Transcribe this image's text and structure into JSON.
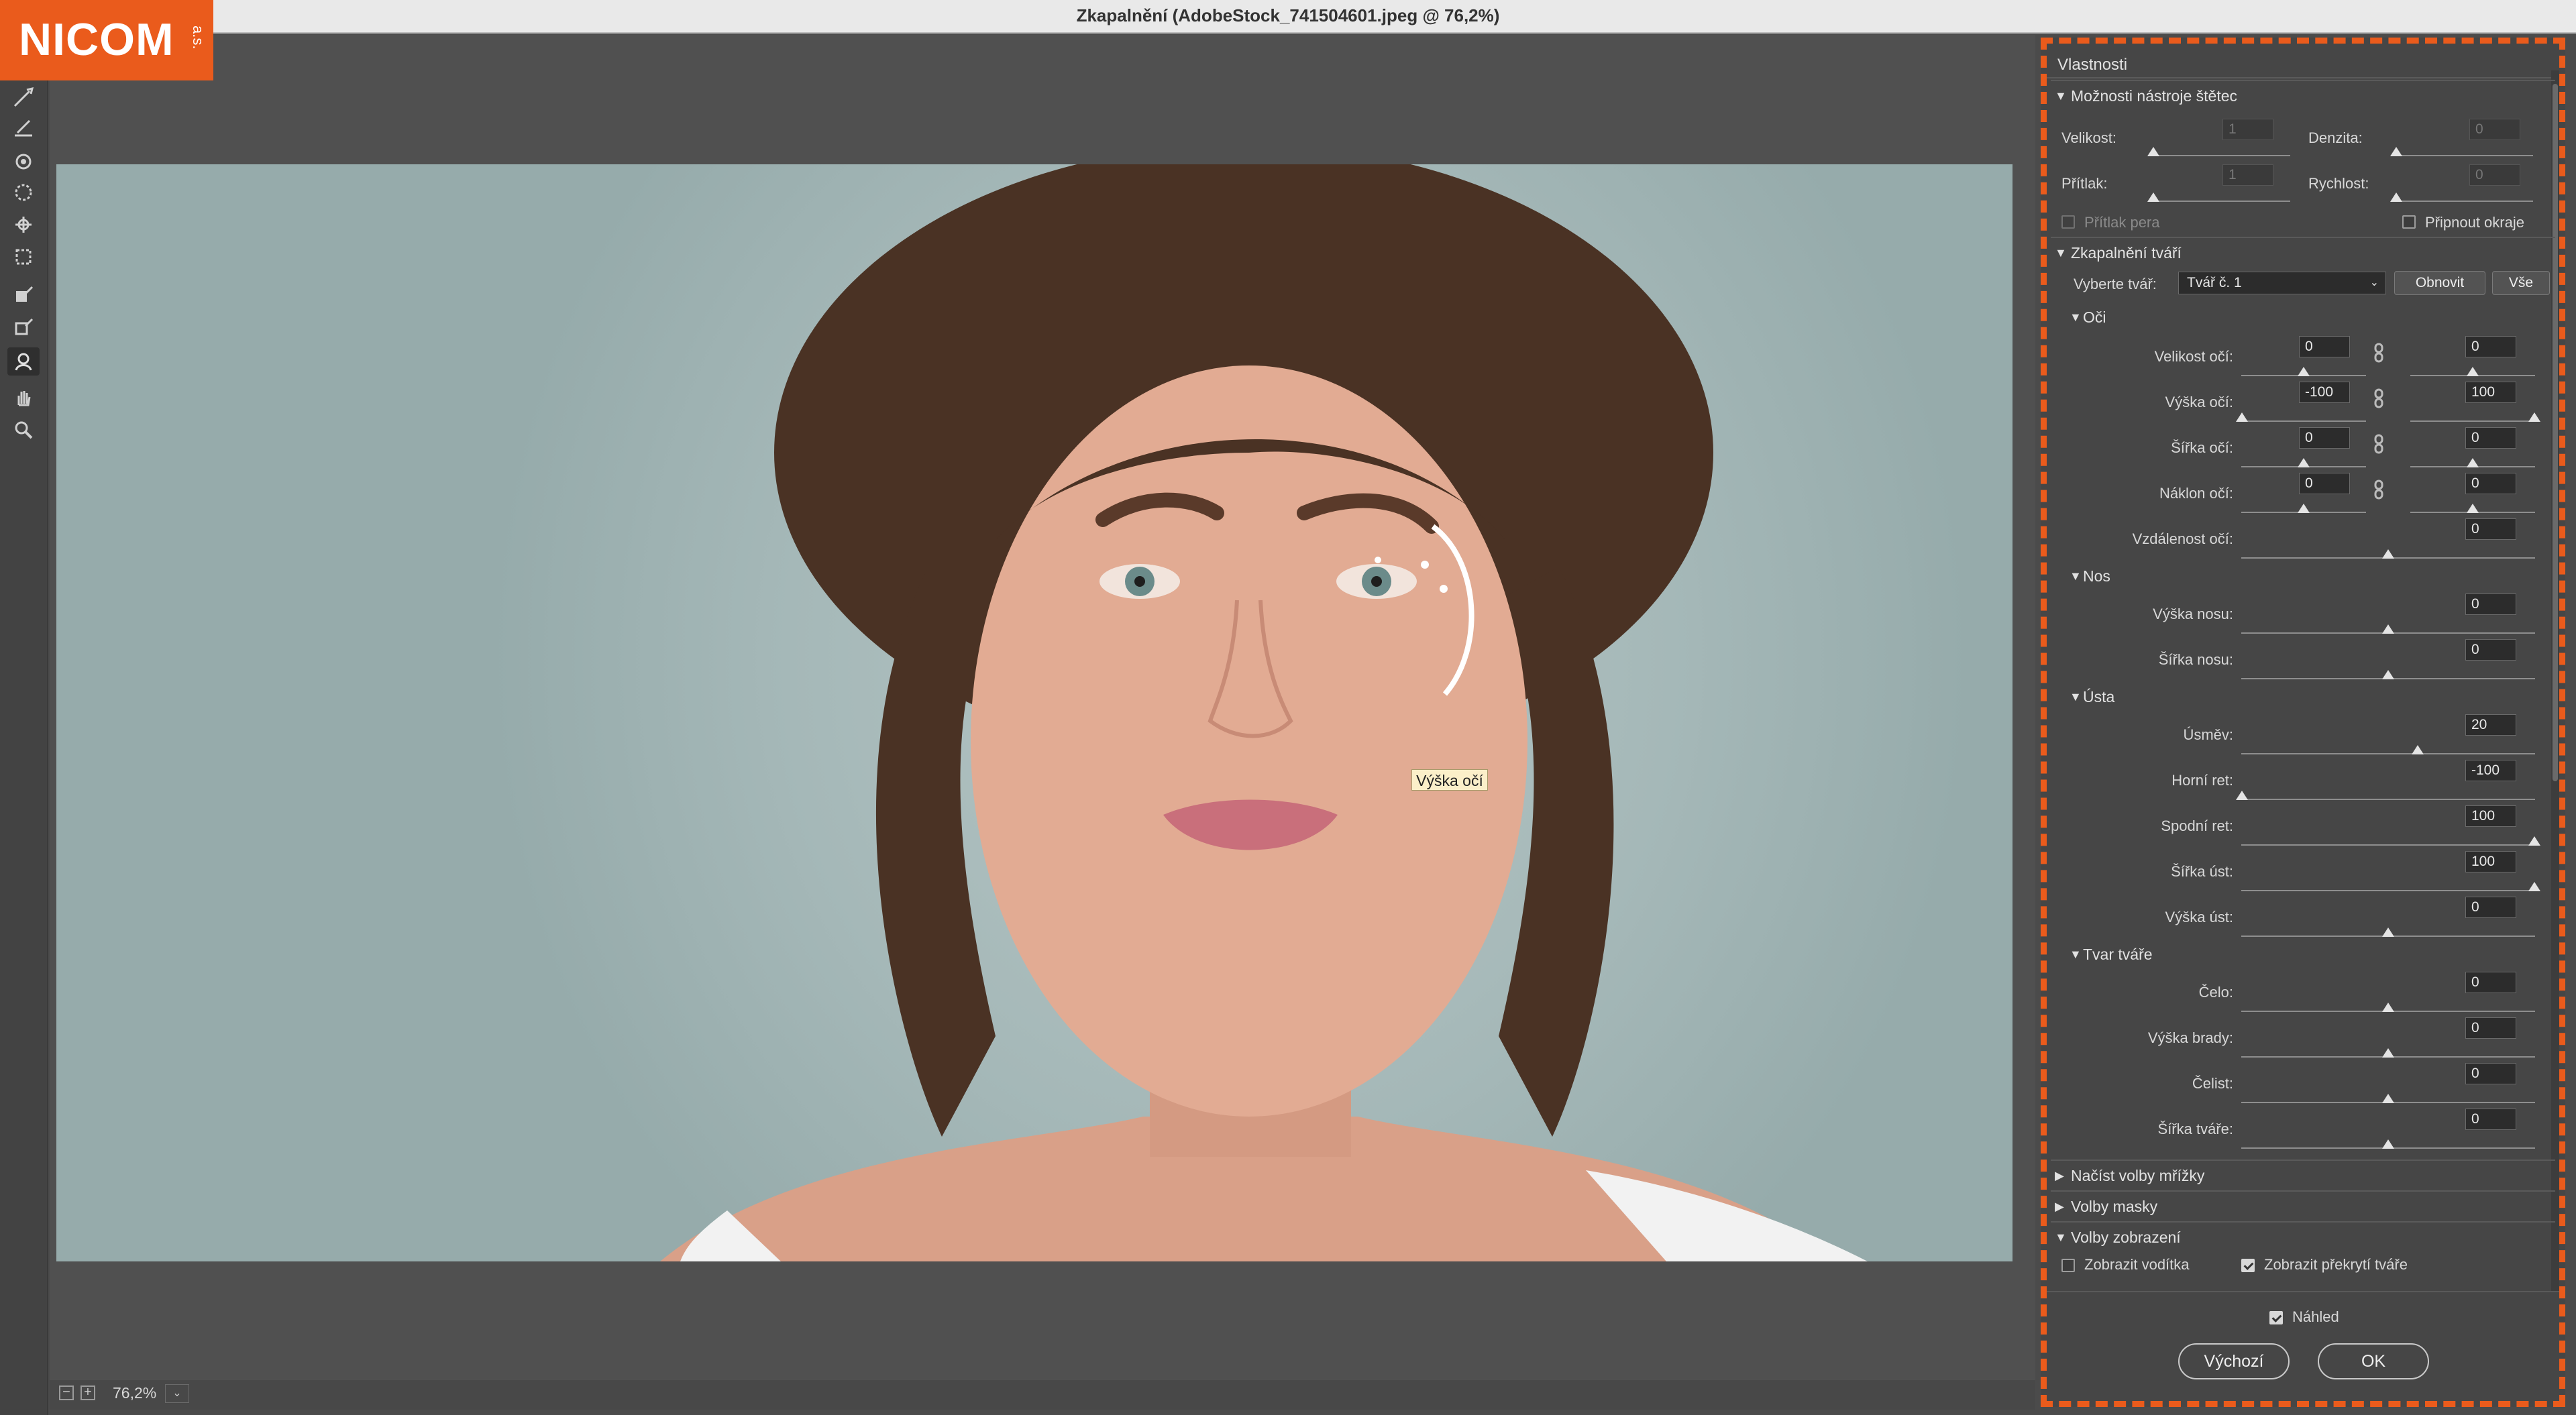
{
  "window": {
    "title": "Zkapalnění (AdobeStock_741504601.jpeg @ 76,2%)"
  },
  "logo": {
    "text": "NICOM",
    "suffix": "a.s."
  },
  "canvas": {
    "tooltip": "Výška očí",
    "zoom": "76,2%",
    "zoom_out": "−",
    "zoom_in": "+",
    "dropdown": "⌄"
  },
  "panel": {
    "title": "Vlastnosti",
    "brush": {
      "title": "Možnosti nástroje štětec",
      "size_label": "Velikost:",
      "size_value": "1",
      "density_label": "Denzita:",
      "density_value": "0",
      "pressure_label": "Přítlak:",
      "pressure_value": "1",
      "rate_label": "Rychlost:",
      "rate_value": "0",
      "pen_pressure": "Přítlak pera",
      "pin_edges": "Připnout okraje"
    },
    "face": {
      "title": "Zkapalnění tváří",
      "select_label": "Vyberte tvář:",
      "select_value": "Tvář č. 1",
      "reset": "Obnovit",
      "all": "Vše",
      "eyes": {
        "title": "Oči",
        "size": "Velikost očí:",
        "size_l": "0",
        "size_r": "0",
        "height": "Výška očí:",
        "height_l": "-100",
        "height_r": "100",
        "width": "Šířka očí:",
        "width_l": "0",
        "width_r": "0",
        "tilt": "Náklon očí:",
        "tilt_l": "0",
        "tilt_r": "0",
        "distance": "Vzdálenost očí:",
        "distance_v": "0"
      },
      "nose": {
        "title": "Nos",
        "height": "Výška nosu:",
        "height_v": "0",
        "width": "Šířka nosu:",
        "width_v": "0"
      },
      "mouth": {
        "title": "Ústa",
        "smile": "Úsměv:",
        "smile_v": "20",
        "upper": "Horní ret:",
        "upper_v": "-100",
        "lower": "Spodní ret:",
        "lower_v": "100",
        "width": "Šířka úst:",
        "width_v": "100",
        "height": "Výška úst:",
        "height_v": "0"
      },
      "shape": {
        "title": "Tvar tváře",
        "forehead": "Čelo:",
        "forehead_v": "0",
        "chin": "Výška brady:",
        "chin_v": "0",
        "jaw": "Čelist:",
        "jaw_v": "0",
        "width": "Šířka tváře:",
        "width_v": "0"
      }
    },
    "mesh": {
      "title": "Načíst volby mřížky"
    },
    "mask": {
      "title": "Volby masky"
    },
    "view": {
      "title": "Volby zobrazení",
      "guides": "Zobrazit vodítka",
      "face_overlay": "Zobrazit překrytí tváře"
    },
    "preview": "Náhled",
    "default": "Výchozí",
    "ok": "OK"
  }
}
